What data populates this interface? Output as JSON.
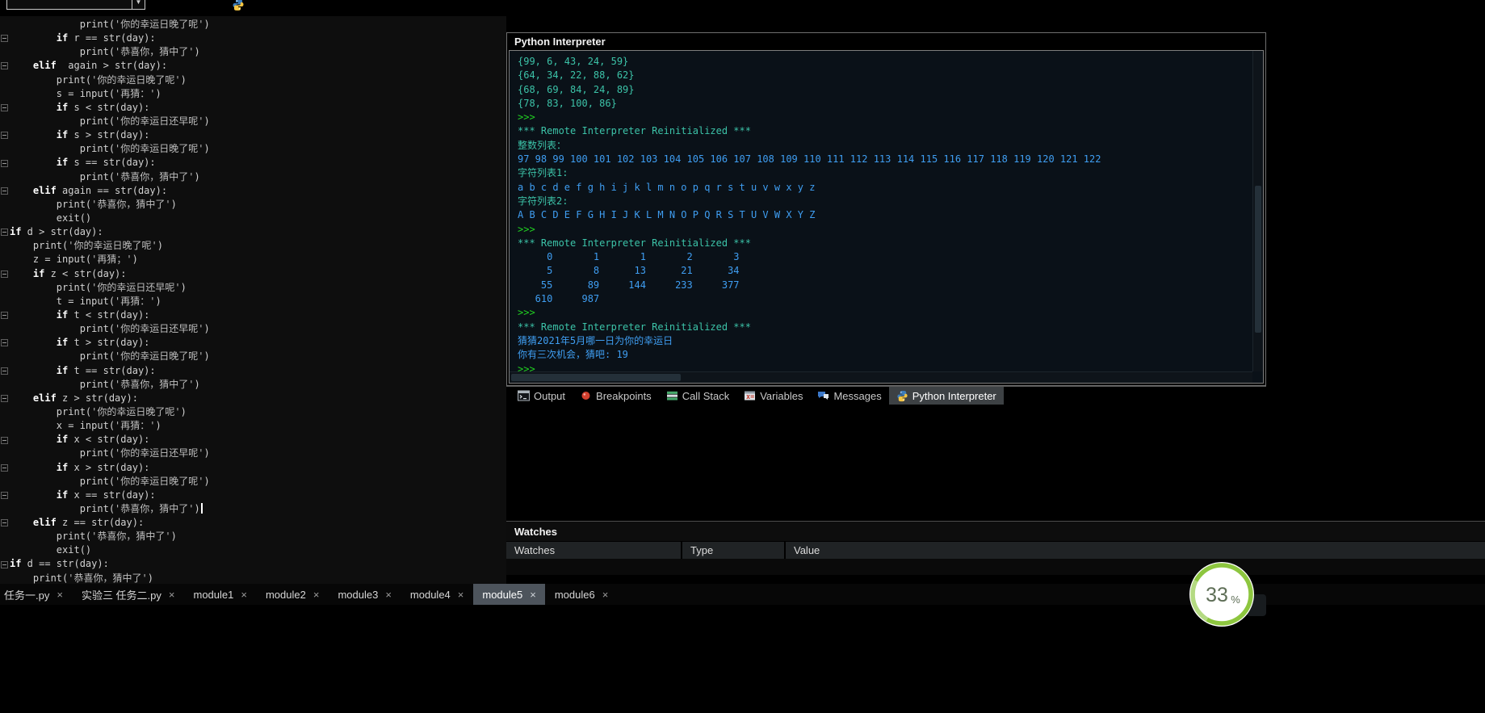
{
  "editor": {
    "cursor_line_index": 35,
    "lines": [
      "            print('你的幸运日晚了呢')",
      "        if r == str(day):",
      "            print('恭喜你，猜中了')",
      "    elif  again > str(day):",
      "        print('你的幸运日晚了呢')",
      "        s = input('再猜：')",
      "        if s < str(day):",
      "            print('你的幸运日还早呢')",
      "        if s > str(day):",
      "            print('你的幸运日晚了呢')",
      "        if s == str(day):",
      "            print('恭喜你，猜中了')",
      "    elif again == str(day):",
      "        print('恭喜你，猜中了')",
      "        exit()",
      "if d > str(day):",
      "    print('你的幸运日晚了呢')",
      "    z = input('再猜；')",
      "    if z < str(day):",
      "        print('你的幸运日还早呢')",
      "        t = input('再猜：')",
      "        if t < str(day):",
      "            print('你的幸运日还早呢')",
      "        if t > str(day):",
      "            print('你的幸运日晚了呢')",
      "        if t == str(day):",
      "            print('恭喜你，猜中了')",
      "    elif z > str(day):",
      "        print('你的幸运日晚了呢')",
      "        x = input('再猜：')",
      "        if x < str(day):",
      "            print('你的幸运日还早呢')",
      "        if x > str(day):",
      "            print('你的幸运日晚了呢')",
      "        if x == str(day):",
      "            print('恭喜你，猜中了')",
      "    elif z == str(day):",
      "        print('恭喜你，猜中了')",
      "        exit()",
      "if d == str(day):",
      "    print('恭喜你，猜中了')"
    ]
  },
  "interpreter": {
    "title": "Python Interpreter",
    "colors": {
      "teal": "#3cc3a8",
      "blue": "#3f9ef2",
      "green": "#21d121"
    },
    "lines": [
      {
        "text": "{99, 6, 43, 24, 59}",
        "color": "teal"
      },
      {
        "text": "{64, 34, 22, 88, 62}",
        "color": "teal"
      },
      {
        "text": "{68, 69, 84, 24, 89}",
        "color": "teal"
      },
      {
        "text": "{78, 83, 100, 86}",
        "color": "teal"
      },
      {
        "text": ">>> ",
        "color": "green"
      },
      {
        "text": "*** Remote Interpreter Reinitialized ***",
        "color": "teal"
      },
      {
        "text": "整数列表：",
        "color": "teal"
      },
      {
        "text": "97 98 99 100 101 102 103 104 105 106 107 108 109 110 111 112 113 114 115 116 117 118 119 120 121 122",
        "color": "blue"
      },
      {
        "text": "字符列表1:",
        "color": "teal"
      },
      {
        "text": "a b c d e f g h i j k l m n o p q r s t u v w x y z",
        "color": "blue"
      },
      {
        "text": "字符列表2:",
        "color": "teal"
      },
      {
        "text": "A B C D E F G H I J K L M N O P Q R S T U V W X Y Z",
        "color": "blue"
      },
      {
        "text": ">>> ",
        "color": "green"
      },
      {
        "text": "*** Remote Interpreter Reinitialized ***",
        "color": "teal"
      },
      {
        "text": "     0       1       1       2       3",
        "color": "blue"
      },
      {
        "text": "     5       8      13      21      34",
        "color": "blue"
      },
      {
        "text": "    55      89     144     233     377",
        "color": "blue"
      },
      {
        "text": "   610     987",
        "color": "blue"
      },
      {
        "text": ">>> ",
        "color": "green"
      },
      {
        "text": "*** Remote Interpreter Reinitialized ***",
        "color": "teal"
      },
      {
        "text": "猜猜2021年5月哪一日为你的幸运日",
        "color": "blue"
      },
      {
        "text": "你有三次机会，猜吧: 19",
        "color": "blue"
      },
      {
        "text": ">>> ",
        "color": "green"
      }
    ]
  },
  "panel_tabs": {
    "items": [
      {
        "label": "Output",
        "icon": "console-icon",
        "selected": false
      },
      {
        "label": "Breakpoints",
        "icon": "breakpoint-icon",
        "selected": false
      },
      {
        "label": "Call Stack",
        "icon": "callstack-icon",
        "selected": false
      },
      {
        "label": "Variables",
        "icon": "variables-icon",
        "selected": false
      },
      {
        "label": "Messages",
        "icon": "messages-icon",
        "selected": false
      },
      {
        "label": "Python Interpreter",
        "icon": "python-logo-icon",
        "selected": true
      }
    ]
  },
  "watches": {
    "title": "Watches",
    "columns": [
      "Watches",
      "Type",
      "Value"
    ]
  },
  "file_tabs": {
    "close_glyph": "×",
    "items": [
      {
        "label": "任务一.py",
        "selected": false
      },
      {
        "label": "实验三 任务二.py",
        "selected": false
      },
      {
        "label": "module1",
        "selected": false
      },
      {
        "label": "module2",
        "selected": false
      },
      {
        "label": "module3",
        "selected": false
      },
      {
        "label": "module4",
        "selected": false
      },
      {
        "label": "module5",
        "selected": true
      },
      {
        "label": "module6",
        "selected": false
      }
    ]
  },
  "overlay_badge": {
    "value": "33",
    "unit": "%",
    "ring_color": "#8dc63f"
  }
}
